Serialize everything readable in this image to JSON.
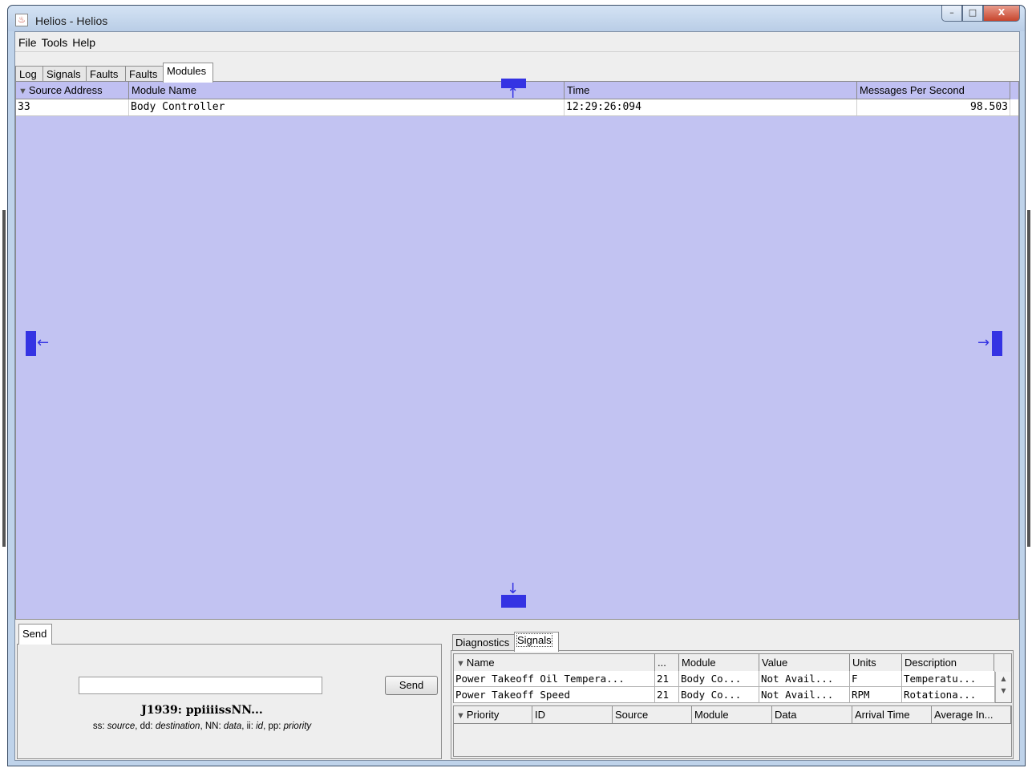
{
  "window": {
    "title": "Helios - Helios",
    "minimize": "–",
    "maximize": "□",
    "close": "X"
  },
  "menu": [
    "File",
    "Tools",
    "Help"
  ],
  "tabs": [
    "Log",
    "Signals",
    "Faults",
    "Faults",
    "Modules"
  ],
  "active_tab": "Modules",
  "modules_table": {
    "columns": [
      "Source Address",
      "Module Name",
      "Time",
      "Messages Per Second"
    ],
    "rows": [
      [
        "33",
        "Body Controller",
        "12:29:26:094",
        "98.503"
      ]
    ]
  },
  "dock_colors": {
    "accent": "#3433e3",
    "panel": "#c2c3f2"
  },
  "send": {
    "tab": "Send",
    "input_value": "",
    "button": "Send",
    "syntax": "J1939: ppiiiissNN...",
    "hint_parts": [
      "ss: ",
      "source",
      ", dd: ",
      "destination",
      ", NN: ",
      "data",
      ", ii: ",
      "id",
      ", pp: ",
      "priority"
    ]
  },
  "signals_pane": {
    "tabs": [
      "Diagnostics",
      "Signals"
    ],
    "active_tab": "Signals",
    "signal_columns": [
      "Name",
      "...",
      "Module",
      "Value",
      "Units",
      "Description"
    ],
    "signal_rows": [
      [
        "Power Takeoff Oil Tempera...",
        "21",
        "Body Co...",
        "Not Avail...",
        "F",
        "Temperatu..."
      ],
      [
        "Power Takeoff Speed",
        "21",
        "Body Co...",
        "Not Avail...",
        "RPM",
        "Rotationa..."
      ]
    ],
    "message_columns": [
      "Priority",
      "ID",
      "Source",
      "Module",
      "Data",
      "Arrival Time",
      "Average In..."
    ]
  },
  "icons": [
    "java-app-icon",
    "filter-icon",
    "dock-top-icon",
    "dock-left-icon",
    "dock-right-icon",
    "dock-bottom-icon",
    "scroll-up-icon",
    "scroll-down-icon"
  ]
}
